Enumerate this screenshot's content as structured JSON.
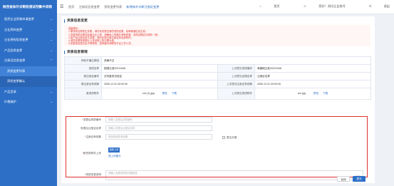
{
  "app": {
    "brand": "陕西省体外诊断检测试剂集中采购"
  },
  "sidebar": {
    "items": [
      {
        "label": "医药企业资格申请变更",
        "expanded": false
      },
      {
        "label": "企业资料变更",
        "expanded": false
      },
      {
        "label": "企业授权信息变更",
        "expanded": false
      },
      {
        "label": "产品信息变更",
        "expanded": false
      },
      {
        "label": "注册证信息变更",
        "expanded": true
      },
      {
        "label": "资质变更列表",
        "sub": true,
        "active": true
      },
      {
        "label": "资质变更确认",
        "sub": true
      },
      {
        "label": "产品目录",
        "expanded": false
      },
      {
        "label": "价格维护",
        "expanded": false
      }
    ]
  },
  "topbar": {
    "crumbs": [
      "首页",
      "注册证信息变更",
      "资质变更列表"
    ],
    "current_crumb": "新增体外诊断注册证变更",
    "home": "首页",
    "user": "您好！测试企业账号",
    "logout": "退出"
  },
  "main": {
    "change_section_title": "资质信息变更",
    "notice_lines": [
      "温馨提示：",
      "1.原资质证照发生变更，请在本页提交新的资质证照，经审核通过后生效；",
      "2.变更资质证照须加盖企业公章，请确保上传图片清晰完整，资质证照应与原件一致；",
      "3.若产品注册证发生变更，请同步提交新注册证的全部附件；",
      "4.资质证照有效期以上传证照上的日期为准；",
      "5.变更信息提交后不得修改，如有疑问请联系平台工作人员。"
    ],
    "info_section_title": "资质信息管理",
    "info_rows": [
      {
        "l1": "体检不通过原因",
        "v1": "资格不过",
        "l2": "",
        "v2": ""
      },
      {
        "l1": "资质名称",
        "v1": "国械注准20211946",
        "l2": "上次提交资质编号",
        "v2": "粤器械注准20221946"
      },
      {
        "l1": "原注册证编号",
        "v1": "试剂盒测试验证",
        "l2": "上次提交证照名称",
        "v2": "注册证名称"
      },
      {
        "l1": "原注册证有效期",
        "v1": "2050.12.31 00:00:00",
        "l2": "上次提交注册证有效期",
        "v2": "2050.12.31 00:00:00"
      }
    ],
    "attachment_row": {
      "label": "原资质附件",
      "file": "zxc (1).jpg",
      "preview": "预览",
      "download": "下载",
      "label2": "上次提交资质附件",
      "file2": "zxc.jpg",
      "preview2": "预览",
      "download2": "下载"
    },
    "form": {
      "new_cert_no_label": "变更后资质编号",
      "new_cert_no_placeholder": "请输入变更后资质编号",
      "new_cert_name_label": "变更后注册证名称",
      "new_cert_name_placeholder": "请输入变更后注册证名称",
      "validity_label": "注册证有效期",
      "validity_placeholder": "请选择资质有效期",
      "long_term_label": "是否长期",
      "upload_label": "新资质附件上传",
      "upload_button": "选择上传",
      "upload_link": "请上传图片",
      "desc_label": "资质变更说明",
      "desc_placeholder": "请输入变更资质的详细信息",
      "desc_counter": "0/200"
    },
    "buttons": {
      "back": "返回",
      "submit": "提交"
    }
  },
  "colors": {
    "sidebar": "#2d6fc7",
    "accent": "#2d6fc7",
    "highlight": "#e03030"
  }
}
